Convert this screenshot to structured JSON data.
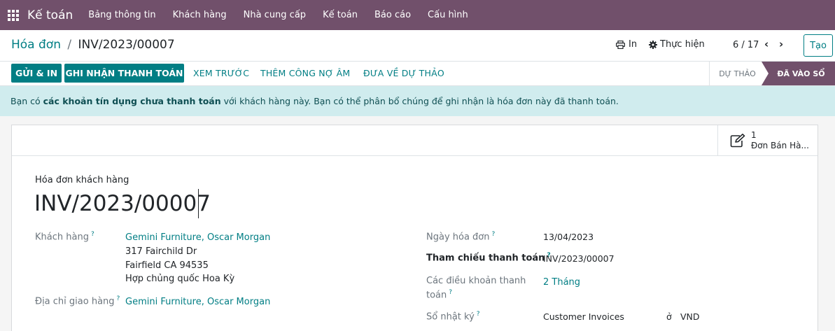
{
  "navbar": {
    "app_name": "Kế toán",
    "menu": [
      "Bảng thông tin",
      "Khách hàng",
      "Nhà cung cấp",
      "Kế toán",
      "Báo cáo",
      "Cấu hình"
    ],
    "bg_color": "#71506b"
  },
  "control": {
    "breadcrumb_parent": "Hóa đơn",
    "breadcrumb_sep": "/",
    "breadcrumb_current": "INV/2023/00007",
    "print_label": "In",
    "action_label": "Thực hiện",
    "pager": "6 / 17",
    "create_label": "Tạo"
  },
  "statusbar": {
    "send_print": "GỬI & IN",
    "register_payment": "GHI NHẬN THANH TOÁN",
    "preview": "XEM TRƯỚC",
    "add_credit_note": "THÊM CÔNG NỢ ÂM",
    "reset_draft": "ĐƯA VỀ DỰ THẢO",
    "stage_draft": "DỰ THẢO",
    "stage_posted": "ĐÃ VÀO SỔ"
  },
  "alert": {
    "prefix": "Bạn có ",
    "bold": "các khoản tín dụng chưa thanh toán",
    "suffix": " với khách hàng này. Bạn có thể phân bổ chúng để ghi nhận là hóa đơn này đã thanh toán."
  },
  "smart_button": {
    "count": "1",
    "label": "Đơn Bán Hà..."
  },
  "form": {
    "doc_type": "Hóa đơn khách hàng",
    "doc_name": "INV/2023/00007",
    "customer_label": "Khách hàng",
    "customer_value": "Gemini Furniture, Oscar Morgan",
    "address": [
      "317 Fairchild Dr",
      "Fairfield CA 94535",
      "Hợp chủng quốc Hoa Kỳ"
    ],
    "delivery_label": "Địa chỉ giao hàng",
    "delivery_value": "Gemini Furniture, Oscar Morgan",
    "invoice_date_label": "Ngày hóa đơn",
    "invoice_date_value": "13/04/2023",
    "payment_ref_label": "Tham chiếu thanh toán",
    "payment_ref_value": "INV/2023/00007",
    "payment_terms_label_1": "Các điều khoản thanh",
    "payment_terms_label_2": "toán",
    "payment_terms_value": "2 Tháng",
    "journal_label": "Sổ nhật ký",
    "journal_value": "Customer Invoices",
    "currency_in": "ở",
    "currency_value": "VND",
    "help_mark": "?"
  }
}
